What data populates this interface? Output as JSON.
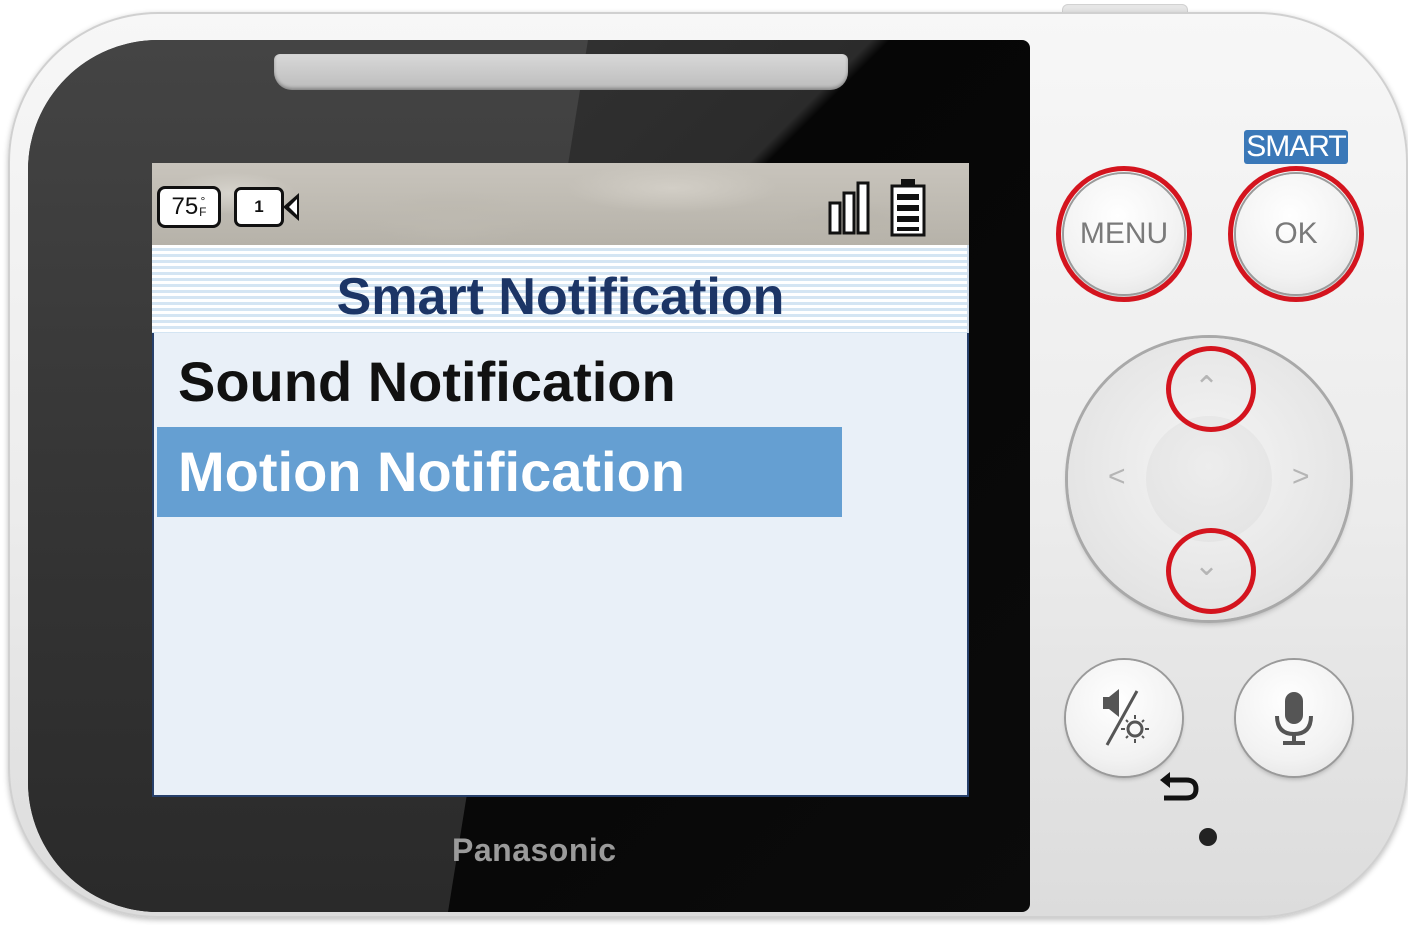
{
  "device": {
    "brand": "Panasonic",
    "smart_label": "SMART"
  },
  "status_bar": {
    "temperature": "75",
    "temperature_degree": "°",
    "temperature_unit": "F",
    "camera_number": "1",
    "signal_icon": "signal-strength-icon",
    "battery_icon": "battery-icon"
  },
  "screen": {
    "title": "Smart Notification",
    "menu_items": [
      {
        "label": "Sound Notification",
        "selected": false
      },
      {
        "label": "Motion Notification",
        "selected": true
      }
    ]
  },
  "buttons": {
    "menu_label": "MENU",
    "ok_label": "OK",
    "dpad_up_icon": "chevron-up-icon",
    "dpad_down_icon": "chevron-down-icon",
    "dpad_left_icon": "chevron-left-icon",
    "dpad_right_icon": "chevron-right-icon",
    "speaker_brightness_icon": "speaker-brightness-icon",
    "talk_icon": "microphone-icon",
    "back_icon": "back-arrow-icon"
  },
  "colors": {
    "highlight": "#d4141e",
    "selection": "#659fd2",
    "title": "#1c3566",
    "smart_badge": "#3a78b8"
  }
}
